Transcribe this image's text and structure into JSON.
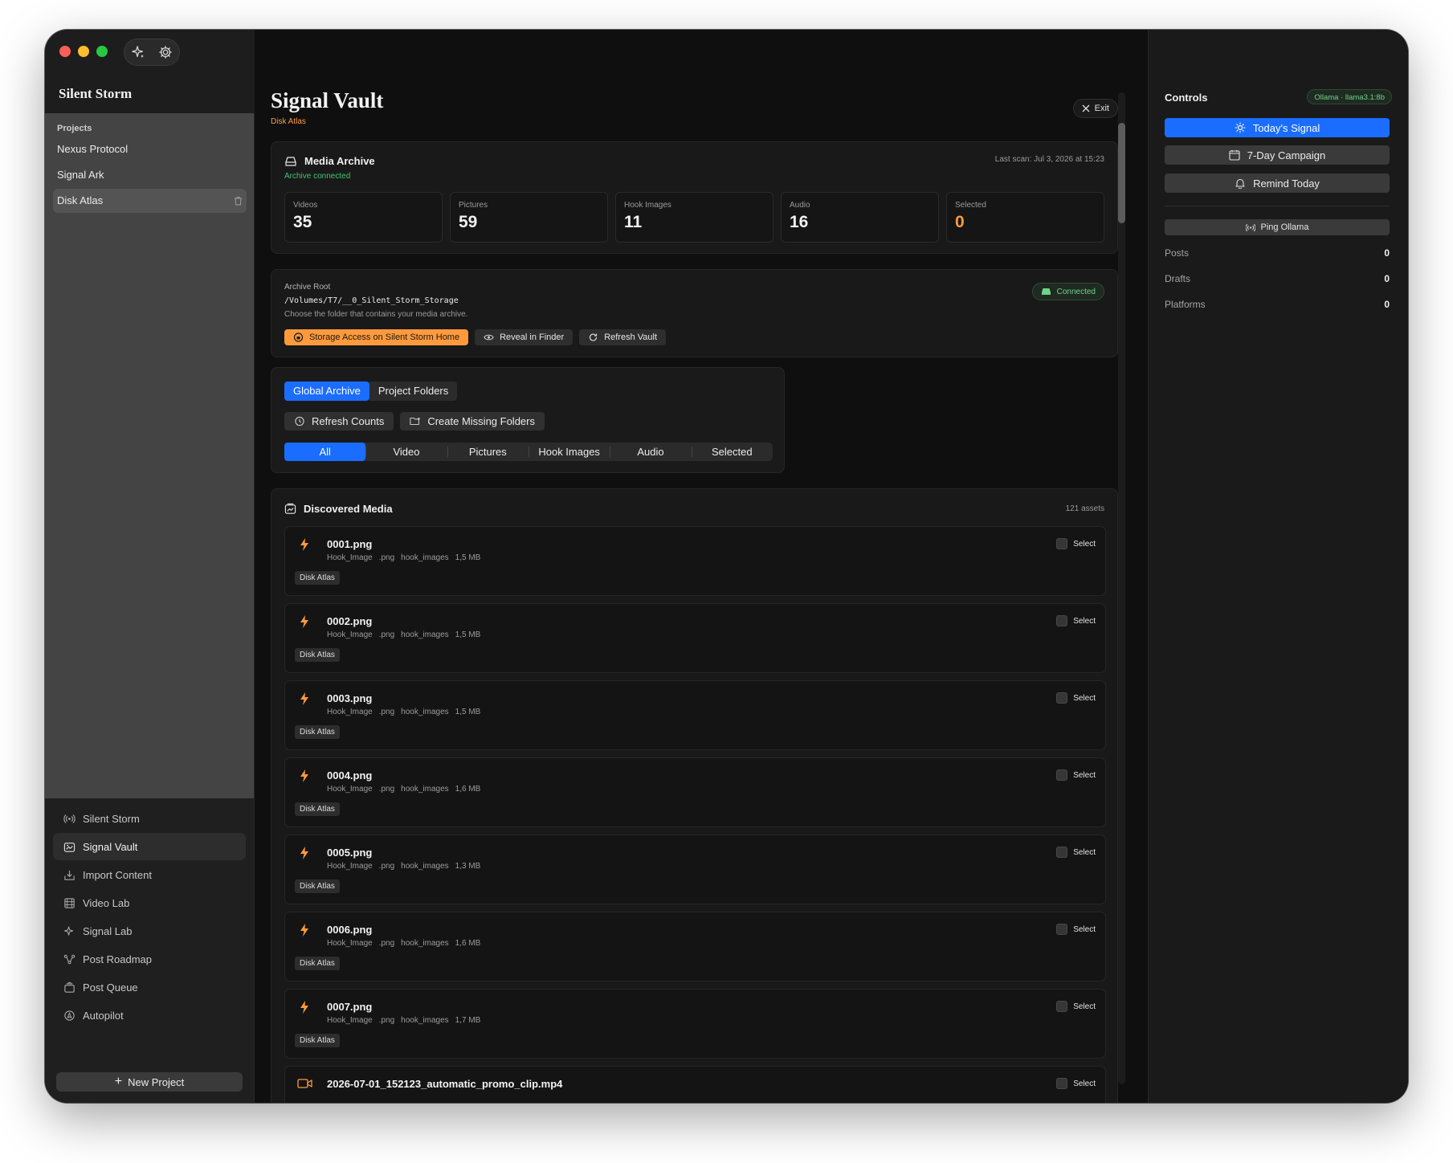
{
  "sidebar": {
    "app_title": "Silent Storm",
    "projects_heading": "Projects",
    "projects": [
      {
        "label": "Nexus Protocol",
        "active": false
      },
      {
        "label": "Signal Ark",
        "active": false
      },
      {
        "label": "Disk Atlas",
        "active": true
      }
    ],
    "nav": [
      {
        "label": "Silent Storm",
        "icon": "broadcast-icon"
      },
      {
        "label": "Signal Vault",
        "icon": "vault-icon",
        "active": true
      },
      {
        "label": "Import Content",
        "icon": "import-icon"
      },
      {
        "label": "Video Lab",
        "icon": "film-icon"
      },
      {
        "label": "Signal Lab",
        "icon": "sparkle-icon"
      },
      {
        "label": "Post Roadmap",
        "icon": "roadmap-icon"
      },
      {
        "label": "Post Queue",
        "icon": "queue-icon"
      },
      {
        "label": "Autopilot",
        "icon": "autopilot-icon"
      }
    ],
    "new_project_label": "New Project"
  },
  "main": {
    "title": "Signal Vault",
    "subtitle": "Disk Atlas",
    "exit_label": "Exit",
    "archive": {
      "heading": "Media Archive",
      "status": "Archive connected",
      "last_scan": "Last scan: Jul 3, 2026 at 15:23",
      "stats": [
        {
          "label": "Videos",
          "value": "35"
        },
        {
          "label": "Pictures",
          "value": "59"
        },
        {
          "label": "Hook Images",
          "value": "11"
        },
        {
          "label": "Audio",
          "value": "16"
        },
        {
          "label": "Selected",
          "value": "0"
        }
      ]
    },
    "root": {
      "label": "Archive Root",
      "path": "/Volumes/T7/__0_Silent_Storm_Storage",
      "hint": "Choose the folder that contains your media archive.",
      "status": "Connected",
      "actions": {
        "storage": "Storage Access on Silent Storm Home",
        "reveal": "Reveal in Finder",
        "refresh": "Refresh Vault"
      }
    },
    "scope_tabs": [
      "Global Archive",
      "Project Folders"
    ],
    "filter_actions": {
      "refresh_counts": "Refresh Counts",
      "create_folders": "Create Missing Folders"
    },
    "filters": [
      "All",
      "Video",
      "Pictures",
      "Hook Images",
      "Audio",
      "Selected"
    ],
    "media": {
      "heading": "Discovered Media",
      "count": "121 assets",
      "select_label": "Select",
      "items": [
        {
          "name": "0001.png",
          "kind": "Hook_Image",
          "ext": ".png",
          "folder": "hook_images",
          "size": "1,5 MB",
          "tag": "Disk Atlas"
        },
        {
          "name": "0002.png",
          "kind": "Hook_Image",
          "ext": ".png",
          "folder": "hook_images",
          "size": "1,5 MB",
          "tag": "Disk Atlas"
        },
        {
          "name": "0003.png",
          "kind": "Hook_Image",
          "ext": ".png",
          "folder": "hook_images",
          "size": "1,5 MB",
          "tag": "Disk Atlas"
        },
        {
          "name": "0004.png",
          "kind": "Hook_Image",
          "ext": ".png",
          "folder": "hook_images",
          "size": "1,6 MB",
          "tag": "Disk Atlas"
        },
        {
          "name": "0005.png",
          "kind": "Hook_Image",
          "ext": ".png",
          "folder": "hook_images",
          "size": "1,3 MB",
          "tag": "Disk Atlas"
        },
        {
          "name": "0006.png",
          "kind": "Hook_Image",
          "ext": ".png",
          "folder": "hook_images",
          "size": "1,6 MB",
          "tag": "Disk Atlas"
        },
        {
          "name": "0007.png",
          "kind": "Hook_Image",
          "ext": ".png",
          "folder": "hook_images",
          "size": "1,7 MB",
          "tag": "Disk Atlas"
        },
        {
          "name": "2026-07-01_152123_automatic_promo_clip.mp4",
          "kind": "",
          "ext": "",
          "folder": "",
          "size": "",
          "tag": ""
        }
      ]
    }
  },
  "controls": {
    "title": "Controls",
    "model": "Ollama · llama3.1:8b",
    "todays_signal": "Today's Signal",
    "campaign": "7-Day Campaign",
    "remind": "Remind Today",
    "ping": "Ping Ollama",
    "rows": [
      {
        "label": "Posts",
        "value": "0"
      },
      {
        "label": "Drafts",
        "value": "0"
      },
      {
        "label": "Platforms",
        "value": "0"
      }
    ]
  },
  "colors": {
    "accent_blue": "#1a6dff",
    "accent_orange": "#ff9a3c",
    "status_green": "#43c56a"
  }
}
